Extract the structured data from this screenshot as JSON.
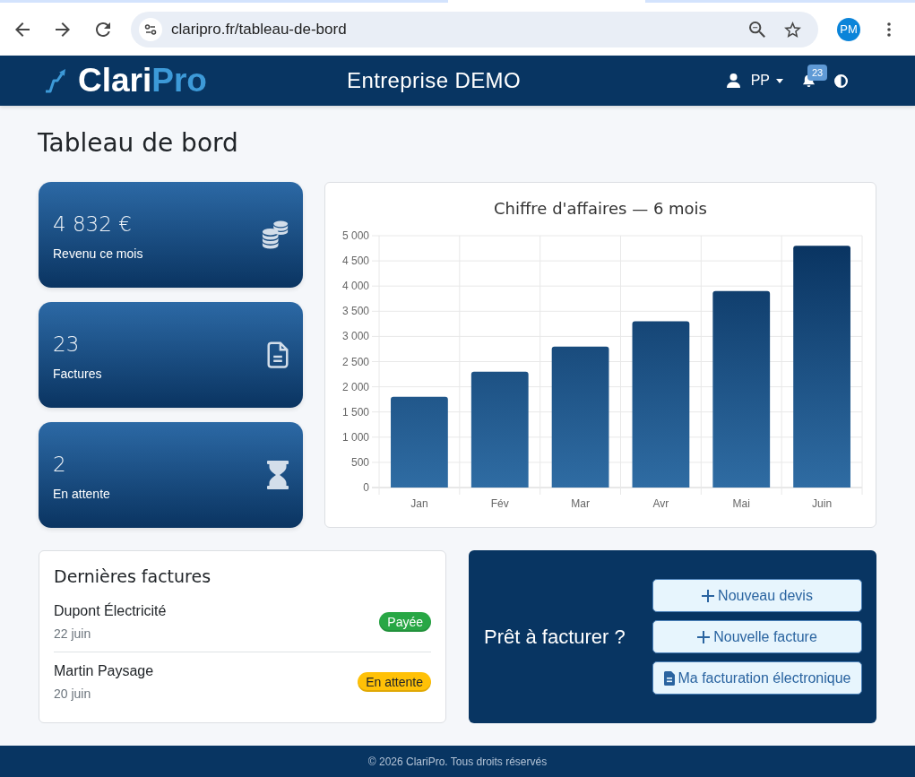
{
  "browser": {
    "url": "claripro.fr/tableau-de-bord",
    "profile_initials": "PM"
  },
  "header": {
    "logo": {
      "text": "Clari",
      "accent": "Pro"
    },
    "company": "Entreprise DEMO",
    "user": "PP",
    "notifications": "23"
  },
  "page": {
    "title": "Tableau de bord"
  },
  "stats": [
    {
      "kind": "revenue",
      "value": "4 832 €",
      "label": "Revenu ce mois"
    },
    {
      "kind": "invoices",
      "value": "23",
      "label": "Factures"
    },
    {
      "kind": "pending",
      "value": "2",
      "label": "En attente"
    }
  ],
  "revenue_chart": {
    "chart_data": {
      "type": "bar",
      "title": "Chiffre d'affaires — 6 mois",
      "categories": [
        "Jan",
        "Fév",
        "Mar",
        "Avr",
        "Mai",
        "Juin"
      ],
      "values": [
        1800,
        2300,
        2800,
        3300,
        3900,
        4800
      ],
      "ylim": [
        0,
        5000
      ],
      "yticks": [
        {
          "value": 0,
          "label": "0"
        },
        {
          "value": 500,
          "label": "500"
        },
        {
          "value": 1000,
          "label": "1 000"
        },
        {
          "value": 1500,
          "label": "1 500"
        },
        {
          "value": 2000,
          "label": "2 000"
        },
        {
          "value": 2500,
          "label": "2 500"
        },
        {
          "value": 3000,
          "label": "3 000"
        },
        {
          "value": 3500,
          "label": "3 500"
        },
        {
          "value": 4000,
          "label": "4 000"
        },
        {
          "value": 4500,
          "label": "4 500"
        },
        {
          "value": 5000,
          "label": "5 000"
        }
      ],
      "grid": true
    }
  },
  "recent_invoices": {
    "title": "Dernières factures",
    "items": [
      {
        "client": "Dupont Électricité",
        "date": "22 juin",
        "status": "Payée",
        "color": "#28a745"
      },
      {
        "client": "Martin Paysage",
        "date": "20 juin",
        "status": "En attente",
        "color": "#ffc107"
      }
    ]
  },
  "call_to_action": {
    "heading": "Prêt à facturer ?",
    "buttons": [
      {
        "kind": "create",
        "label": "Nouveau devis"
      },
      {
        "kind": "create",
        "label": "Nouvelle facture"
      },
      {
        "kind": "document",
        "label": "Ma facturation électronique"
      }
    ]
  },
  "footer": {
    "text": "© 2026 ClariPro. Tous droits réservés"
  }
}
